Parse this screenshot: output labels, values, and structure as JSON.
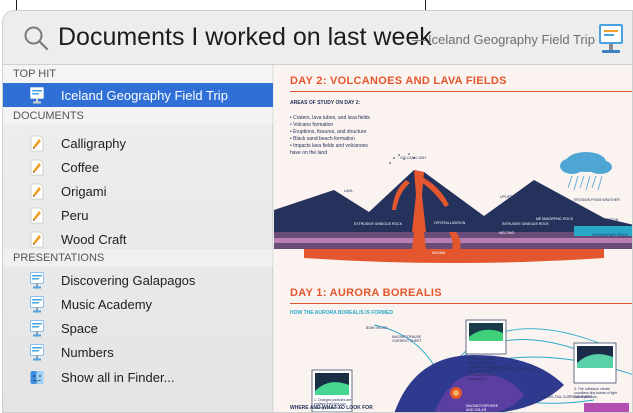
{
  "search": {
    "query": "Documents I worked on last week",
    "separator": "—",
    "suggestion": "Iceland Geography Field Trip"
  },
  "sections": {
    "top_hit": "TOP HIT",
    "documents": "DOCUMENTS",
    "presentations": "PRESENTATIONS"
  },
  "top_hit": {
    "label": "Iceland Geography Field Trip",
    "icon": "keynote-icon"
  },
  "documents": [
    {
      "label": "Calligraphy",
      "icon": "pages-icon"
    },
    {
      "label": "Coffee",
      "icon": "pages-icon"
    },
    {
      "label": "Origami",
      "icon": "pages-icon"
    },
    {
      "label": "Peru",
      "icon": "pages-icon"
    },
    {
      "label": "Wood Craft",
      "icon": "pages-icon"
    }
  ],
  "presentations": [
    {
      "label": "Discovering Galapagos",
      "icon": "keynote-icon"
    },
    {
      "label": "Music Academy",
      "icon": "keynote-icon"
    },
    {
      "label": "Space",
      "icon": "keynote-icon"
    },
    {
      "label": "Numbers",
      "icon": "keynote-icon"
    }
  ],
  "show_all": {
    "label": "Show all in Finder...",
    "icon": "finder-icon"
  },
  "preview": {
    "slide1": {
      "title": "DAY 2: VOLCANOES AND LAVA FIELDS",
      "subtitle": "AREAS OF STUDY ON DAY 2:",
      "bullets": [
        "• Craters, lava tubes, and lava fields",
        "• Volcano formation",
        "• Eruptions, fissures, and structure",
        "• Black sand beach formation",
        "• Impacts lava fields and volcanoes",
        "  have on the land"
      ],
      "labels": {
        "volcanic_ash": "VOLCANIC ASH",
        "lava": "LAVA",
        "uplift": "UPLIFT TO SURFACE",
        "erosion": "EROSION FROM WEATHER",
        "sedimentation": "SEDIMENTATION",
        "extrusive": "EXTRUSIVE IGNEOUS ROCK",
        "crystallization": "CRYSTALLIZATION",
        "intrusive": "INTRUSIVE IGNEOUS ROCK",
        "metamorphic": "METAMORPHIC ROCK",
        "melting": "MELTING",
        "sedimentary": "SEDIMENTARY ROCK",
        "magma": "MAGMA"
      }
    },
    "slide2": {
      "title": "DAY 1: AURORA BOREALIS",
      "subtitle": "HOW THE AURORA BOREALIS IS FORMED",
      "footer": "WHERE AND WHAT TO LOOK FOR",
      "labels": {
        "bow_shock": "BOW SHOCK",
        "current_sheet": "MAGNETOPAUSE CURRENT SHEET",
        "open_closed": "OPEN-CLOSED BOUNDARY",
        "particles": "2. These particles penetrate Earth's magnetic shield, colliding with atoms and molecules in our atmosphere.",
        "charged": "1. Charged particles are emitted from the sun during a solar flare.",
        "collisions": "3. The collisions create countless tiny bursts of light called photons.",
        "cross_tail": "CROSS-TAIL CURRENT SHEET",
        "magnetosphere": "MAGNETOSPHERE AND SOLAR WIND"
      }
    }
  },
  "colors": {
    "selection": "#2f6fd6",
    "accent": "#e4572e",
    "navy": "#24325c",
    "cyan": "#29a9c9"
  }
}
